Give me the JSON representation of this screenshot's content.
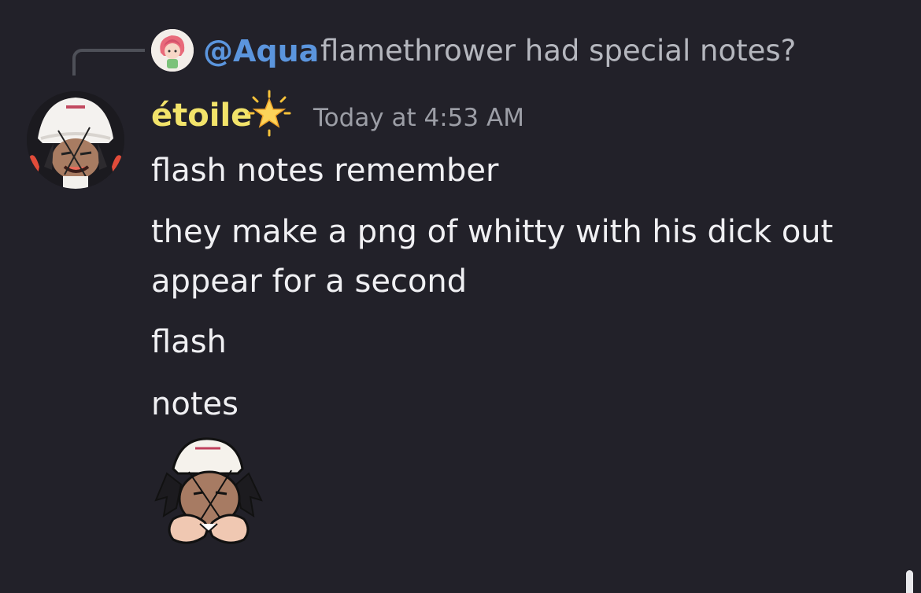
{
  "reply": {
    "mention": "@Aqua",
    "text": "flamethrower had special notes?"
  },
  "message": {
    "author": "étoile",
    "timestamp": "Today at 4:53 AM",
    "lines": [
      "flash notes remember",
      "they make a png of whitty with his dick out",
      "appear for a second",
      "flash",
      "notes"
    ]
  },
  "colors": {
    "background": "#222129",
    "mention": "#5b95dd",
    "username": "#f2e36a",
    "timestamp": "#9c9ea6",
    "message_text": "#f0f0f3"
  },
  "icons": {
    "reply_avatar": "aqua-avatar-icon",
    "author_avatar": "etoile-avatar-icon",
    "badge": "glowing-star-icon",
    "sticker": "whitty-sticker-icon"
  }
}
